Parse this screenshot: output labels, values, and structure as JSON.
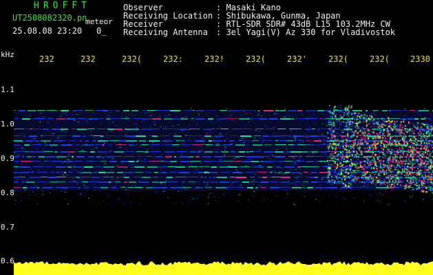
{
  "header": {
    "logo": "HROFFT",
    "filename": "UT2508082320.pn",
    "mode": "meteor",
    "datetime": "25.08.08 23:20",
    "count": "0_"
  },
  "info": [
    {
      "label": "Observer",
      "value": ": Masaki Kano"
    },
    {
      "label": "Receiving Location",
      "value": ": Shibukawa, Gunma, Japan"
    },
    {
      "label": "Receiver",
      "value": ": RTL-SDR SDR# 43dB L15 103.2MHz CW"
    },
    {
      "label": "Receiving Antenna",
      "value": ": 3el Yagi(V) Az 330 for Vladivostok"
    }
  ],
  "axis": {
    "y_unit": "kHz",
    "y_ticks": [
      "1.1",
      "1.0",
      "0.9",
      "0.8",
      "0.7",
      "0.6"
    ],
    "x_ticks": [
      "232",
      "232",
      "232(",
      "232:",
      "232!",
      "232(",
      "232'",
      "232(",
      "232(",
      "2330"
    ]
  },
  "colors": {
    "background": "#000000",
    "header_text": "#3fe640",
    "label_text": "#f2f2f2",
    "tick_text": "#f2e21e",
    "signal_low": "#1f3fff",
    "signal_mid": "#19e6a0",
    "signal_high": "#ff2d7a",
    "noise_floor": "#ffff1e"
  }
}
